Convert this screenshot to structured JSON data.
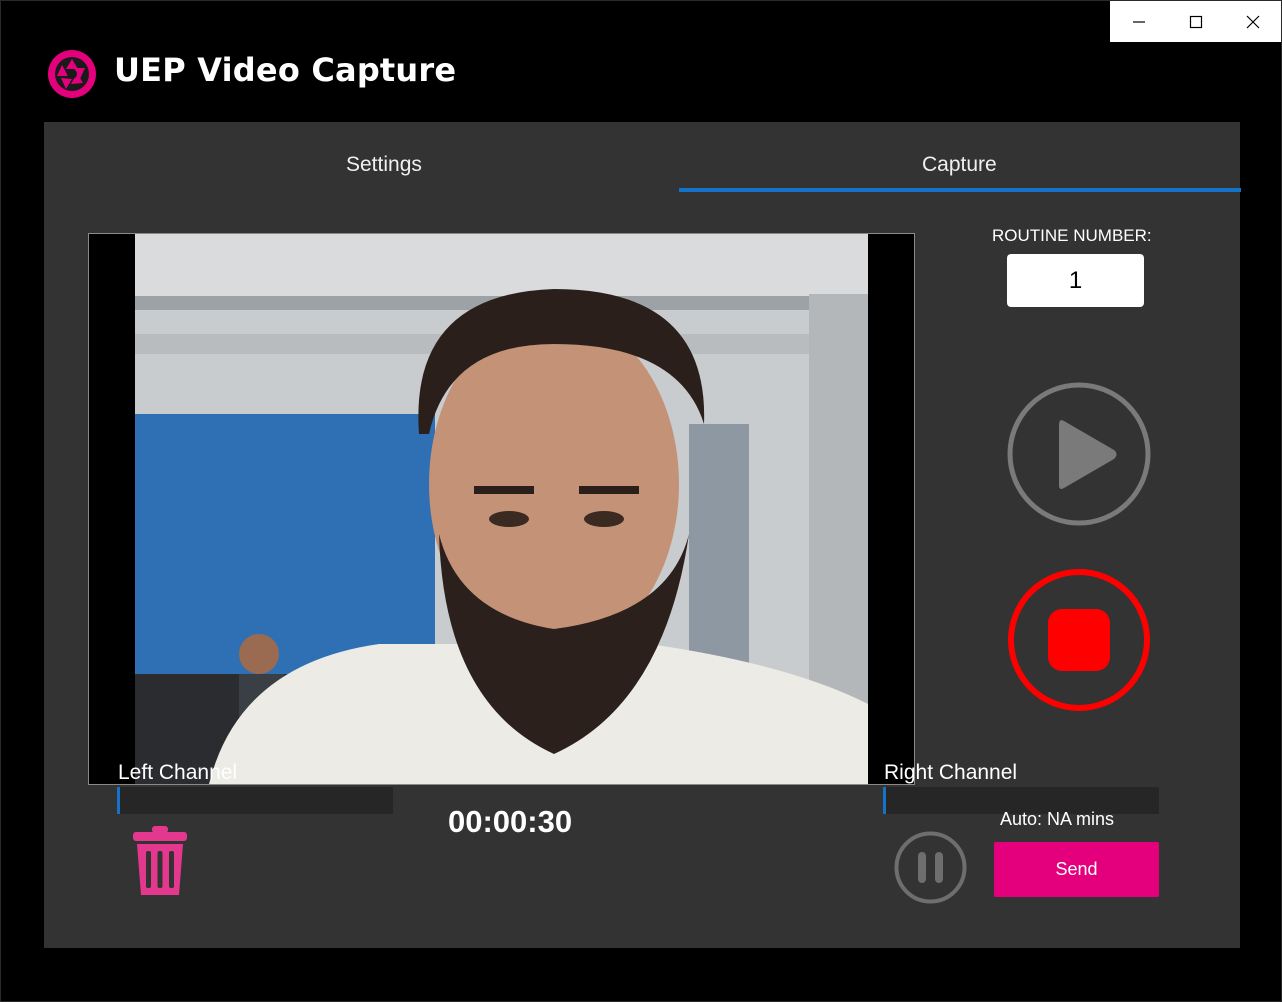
{
  "window": {
    "title": "UEP Video Capture",
    "controls": {
      "minimize_icon": "minimize-icon",
      "maximize_icon": "maximize-icon",
      "close_icon": "close-icon"
    }
  },
  "tabs": [
    {
      "label": "Settings",
      "selected": false
    },
    {
      "label": "Capture",
      "selected": true
    }
  ],
  "capture": {
    "left_channel_label": "Left Channel",
    "right_channel_label": "Right Channel",
    "left_level": 0.01,
    "right_level": 0.01,
    "timer": "00:00:30",
    "routine_label": "ROUTINE NUMBER:",
    "routine_value": "1",
    "auto_text": "Auto: NA mins",
    "send_label": "Send"
  },
  "colors": {
    "accent": "#e4007c",
    "tab_underline": "#1473c8",
    "record": "#ff0000",
    "panel": "#333333"
  }
}
